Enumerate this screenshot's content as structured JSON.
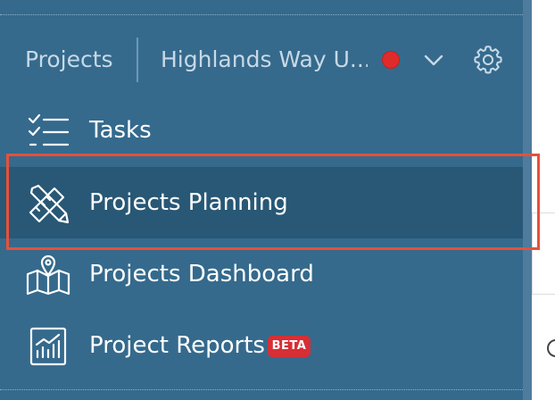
{
  "header": {
    "section_label": "Projects",
    "project_name": "Highlands Way U...",
    "status_color": "#e02b2b",
    "dropdown_icon": "chevron-down-icon",
    "settings_icon": "gear-icon"
  },
  "nav": {
    "items": [
      {
        "label": "Tasks",
        "icon": "checklist-icon",
        "selected": false
      },
      {
        "label": "Projects Planning",
        "icon": "pencil-ruler-icon",
        "selected": true
      },
      {
        "label": "Projects Dashboard",
        "icon": "map-pin-icon",
        "selected": false
      },
      {
        "label": "Project Reports",
        "icon": "bar-chart-icon",
        "selected": false,
        "badge": "BETA"
      }
    ]
  },
  "colors": {
    "sidebar_bg": "#356a8d",
    "selected_bg": "#285875",
    "highlight_border": "#e8503a",
    "badge_bg": "#d62f35"
  }
}
